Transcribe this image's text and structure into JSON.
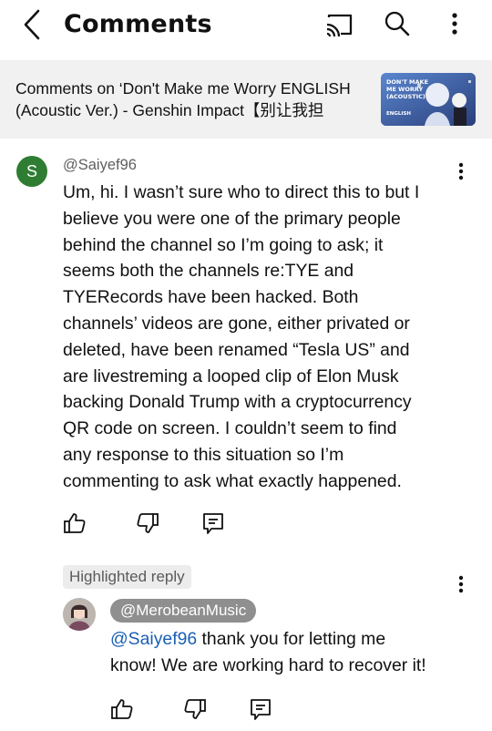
{
  "header": {
    "title": "Comments",
    "icons": [
      "back-chevron-icon",
      "cast-icon",
      "search-icon",
      "more-vert-icon"
    ]
  },
  "video": {
    "title_line1": "Comments on ‘Don't Make me Worry ENGLISH",
    "title_line2": "(Acoustic Ver.) - Genshin Impact【别让我担心】|...",
    "thumbnail_text": "DON'T MAKE\nME WORRY\n(ACOUSTIC)",
    "thumbnail_subtext": "ENGLISH"
  },
  "comment": {
    "avatar_letter": "S",
    "avatar_color": "#2e7d32",
    "author": "@Saiyef96",
    "lines": [
      "Um, hi. I wasn’t sure who to direct this to but I",
      "believe you were one of the primary people",
      "behind the channel so I’m going to ask; it",
      "seems both the channels re:TYE and",
      "TYERecords have been hacked. Both",
      "channels’ videos are gone, either privated or",
      "deleted, have been renamed “Tesla US” and",
      "are livestreming a looped clip of Elon Musk",
      "backing Donald Trump with a cryptocurrency",
      "QR code on screen. I couldn’t seem to find",
      "any response to this situation so I’m",
      "commenting to ask what exactly happened."
    ],
    "actions": [
      "like-icon",
      "dislike-icon",
      "reply-icon"
    ]
  },
  "reply": {
    "badge": "Highlighted reply",
    "author": "@MerobeanMusic",
    "mention": "@Saiyef96",
    "line1_rest": " thank you for letting me",
    "line2": "know! We are working hard to recover it!",
    "actions": [
      "like-icon",
      "dislike-icon",
      "reply-icon"
    ]
  },
  "colors": {
    "header_bg": "#f1f1f1",
    "link": "#1a5fb4",
    "author_chip": "#8f8f8f"
  }
}
